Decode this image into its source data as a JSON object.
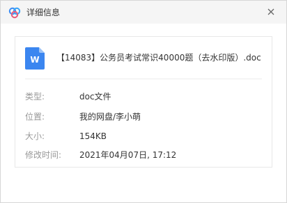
{
  "dialog": {
    "title": "详细信息",
    "icons": {
      "app": "baidu-netdisk-logo-icon",
      "close": "close-icon",
      "file": "word-doc-icon"
    }
  },
  "file": {
    "name": "【14083】公务员考试常识40000题（去水印版）.doc",
    "icon_letter": "W",
    "icon_color": "#3b86f0"
  },
  "details": {
    "type": {
      "label": "类型:",
      "value": "doc文件"
    },
    "location": {
      "label": "位置:",
      "value": "我的网盘/李小萌"
    },
    "size": {
      "label": "大小:",
      "value": "154KB"
    },
    "modified": {
      "label": "修改时间:",
      "value": "2021年04月07日, 17:12"
    }
  },
  "colors": {
    "titlebar_bg": "#f5f5f5",
    "label_text": "#999999",
    "value_text": "#333333",
    "logo_blue": "#3b8cf5",
    "logo_pink": "#e85a7a"
  }
}
